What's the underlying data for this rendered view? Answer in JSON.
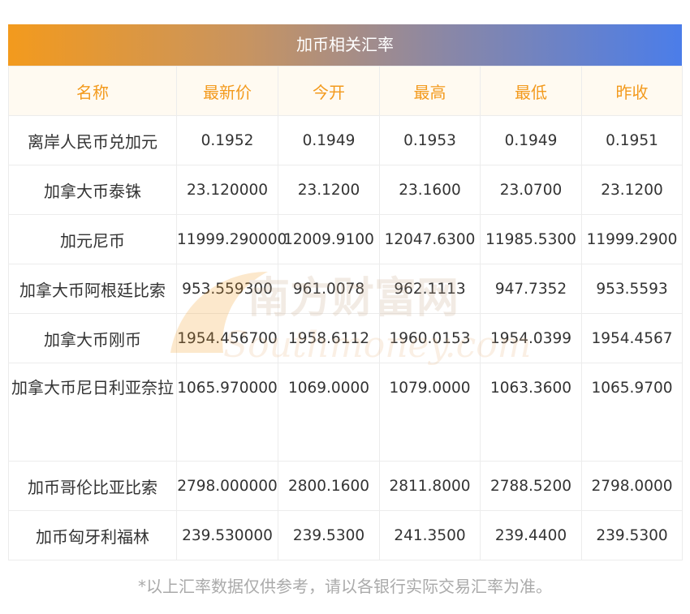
{
  "title": "加币相关汇率",
  "headers": [
    "名称",
    "最新价",
    "今开",
    "最高",
    "最低",
    "昨收"
  ],
  "rows": [
    {
      "name": "离岸人民币兑加元",
      "latest": "0.1952",
      "open": "0.1949",
      "high": "0.1953",
      "low": "0.1949",
      "prev": "0.1951"
    },
    {
      "name": "加拿大币泰铢",
      "latest": "23.120000",
      "open": "23.1200",
      "high": "23.1600",
      "low": "23.0700",
      "prev": "23.1200"
    },
    {
      "name": "加元尼币",
      "latest": "11999.290000",
      "open": "12009.9100",
      "high": "12047.6300",
      "low": "11985.5300",
      "prev": "11999.2900"
    },
    {
      "name": "加拿大币阿根廷比索",
      "latest": "953.559300",
      "open": "961.0078",
      "high": "962.1113",
      "low": "947.7352",
      "prev": "953.5593"
    },
    {
      "name": "加拿大币刚币",
      "latest": "1954.456700",
      "open": "1958.6112",
      "high": "1960.0153",
      "low": "1954.0399",
      "prev": "1954.4567"
    },
    {
      "name": "加拿大币尼日利亚奈拉",
      "latest": "1065.970000",
      "open": "1069.0000",
      "high": "1079.0000",
      "low": "1063.3600",
      "prev": "1065.9700"
    },
    {
      "name": "加币哥伦比亚比索",
      "latest": "2798.000000",
      "open": "2800.1600",
      "high": "2811.8000",
      "low": "2788.5200",
      "prev": "2798.0000"
    },
    {
      "name": "加币匈牙利福林",
      "latest": "239.530000",
      "open": "239.5300",
      "high": "241.3500",
      "low": "239.4400",
      "prev": "239.5300"
    }
  ],
  "footnote": "*以上汇率数据仅供参考，请以各银行实际交易汇率为准。",
  "watermark": {
    "cn": "南方财富网",
    "en": "Southmoney.com"
  },
  "colors": {
    "accent": "#f39a1d",
    "header_bg": "#fffaf1",
    "gradient_end": "#4b7de9"
  }
}
